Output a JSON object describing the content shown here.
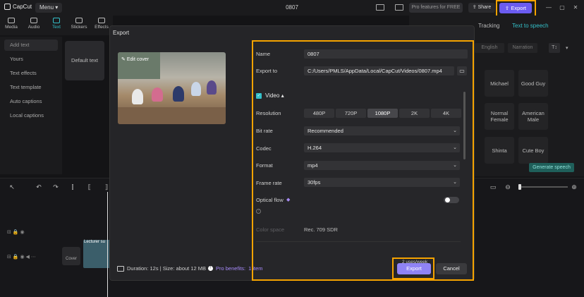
{
  "app": {
    "name": "CapCut",
    "menu_label": "Menu",
    "project_title": "0807"
  },
  "topbar": {
    "pro_label": "Pro features for FREE",
    "share_label": "Share",
    "export_label": "Export"
  },
  "toolbar": {
    "tabs": [
      {
        "label": "Media"
      },
      {
        "label": "Audio"
      },
      {
        "label": "Text"
      },
      {
        "label": "Stickers"
      },
      {
        "label": "Effects"
      }
    ]
  },
  "sidebar": {
    "items": [
      {
        "label": "Add text"
      },
      {
        "label": "Yours"
      },
      {
        "label": "Text effects"
      },
      {
        "label": "Text template"
      },
      {
        "label": "Auto captions"
      },
      {
        "label": "Local captions"
      }
    ]
  },
  "text_panel": {
    "default_text": "Default text"
  },
  "right_panel": {
    "tabs": [
      "Tracking",
      "Text to speech"
    ],
    "filters": [
      "English",
      "Narration"
    ],
    "voices": [
      "Michael",
      "Good Guy",
      "Normal Female",
      "American Male",
      "Shinta",
      "Cute Boy"
    ],
    "generate_label": "Generate speech"
  },
  "timeline": {
    "clip_label": "Lecturer su",
    "cover_label": "Cover"
  },
  "export_dialog": {
    "title": "Export",
    "edit_cover": "Edit cover",
    "name_label": "Name",
    "name_value": "0807",
    "export_to_label": "Export to",
    "export_to_value": "C:/Users/PMLS/AppData/Local/CapCut/Videos/0807.mp4",
    "video_label": "Video",
    "resolution_label": "Resolution",
    "resolutions": [
      "480P",
      "720P",
      "1080P",
      "2K",
      "4K"
    ],
    "resolution_selected": "1080P",
    "bitrate_label": "Bit rate",
    "bitrate_value": "Recommended",
    "codec_label": "Codec",
    "codec_value": "H.264",
    "format_label": "Format",
    "format_value": "mp4",
    "framerate_label": "Frame rate",
    "framerate_value": "30fps",
    "optical_flow_label": "Optical flow",
    "color_space_label": "Color space",
    "color_space_value": "Rec. 709 SDR",
    "duration_text": "Duration: 12s | Size: about 12 MB",
    "pro_benefits_label": "Pro benefits:",
    "pro_benefits_link": "1 item",
    "uses_text": "2 uses/week",
    "export_button": "Export",
    "cancel_button": "Cancel"
  },
  "colors": {
    "accent": "#34c0c9",
    "export_purple": "#8f83f5",
    "highlight": "#f5a300"
  }
}
